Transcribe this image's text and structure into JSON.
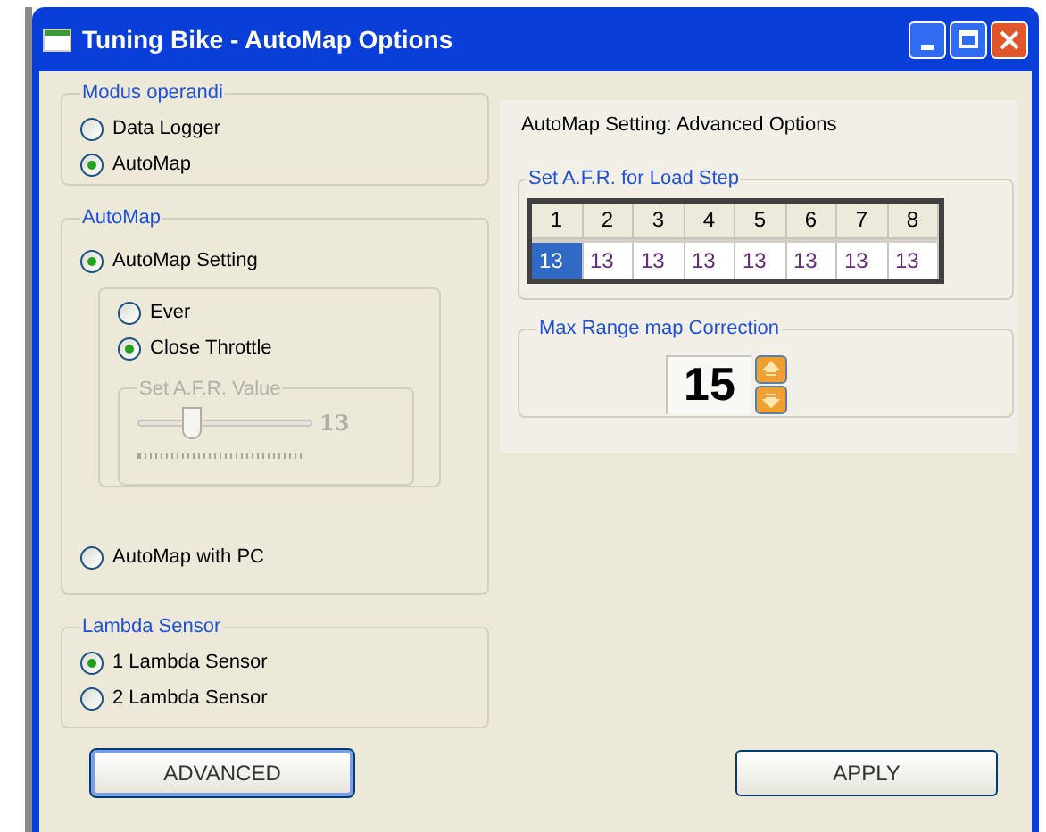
{
  "window": {
    "title": "Tuning Bike - AutoMap Options"
  },
  "modus": {
    "title": "Modus operandi",
    "options": [
      {
        "label": "Data Logger",
        "selected": false
      },
      {
        "label": "AutoMap",
        "selected": true
      }
    ]
  },
  "automap": {
    "title": "AutoMap",
    "options": [
      {
        "label": "AutoMap Setting",
        "selected": true
      },
      {
        "label": "AutoMap with PC",
        "selected": false
      }
    ],
    "sub_options": [
      {
        "label": "Ever",
        "selected": false
      },
      {
        "label": "Close Throttle",
        "selected": true
      }
    ],
    "afr": {
      "title": "Set A.F.R. Value",
      "level": 0.3,
      "reading": "13",
      "disabled": true
    }
  },
  "lambda": {
    "title": "Lambda Sensor",
    "options": [
      {
        "label": "1 Lambda Sensor",
        "selected": true
      },
      {
        "label": "2 Lambda Sensor",
        "selected": false
      }
    ]
  },
  "advanced": {
    "heading": "AutoMap Setting: Advanced Options",
    "load_step": {
      "title": "Set A.F.R. for Load Step",
      "columns": [
        "1",
        "2",
        "3",
        "4",
        "5",
        "6",
        "7",
        "8"
      ],
      "values": [
        {
          "value": "13",
          "selected": true
        },
        {
          "value": "13",
          "selected": false
        },
        {
          "value": "13",
          "selected": false
        },
        {
          "value": "13",
          "selected": false
        },
        {
          "value": "13",
          "selected": false
        },
        {
          "value": "13",
          "selected": false
        },
        {
          "value": "13",
          "selected": false
        },
        {
          "value": "13",
          "selected": false
        }
      ]
    },
    "max_range": {
      "title": "Max Range map Correction",
      "value": "15"
    }
  },
  "buttons": [
    "ADVANCED",
    "APPLY"
  ]
}
